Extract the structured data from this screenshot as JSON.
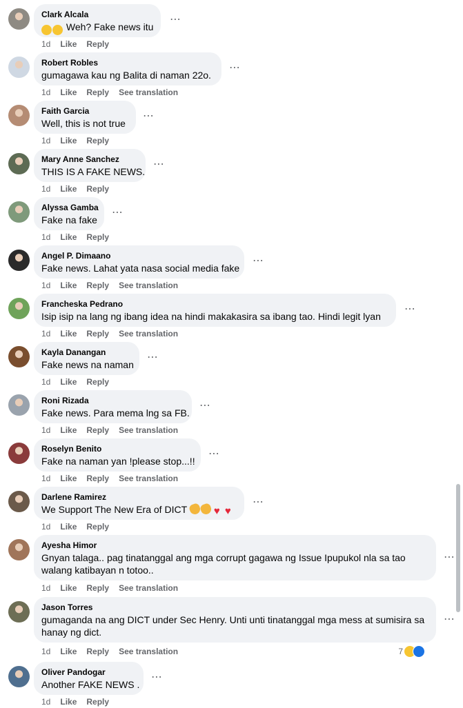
{
  "actions": {
    "like": "Like",
    "reply": "Reply",
    "see_translation": "See translation"
  },
  "more_icon": "⋯",
  "comments": [
    {
      "author": "Clark Alcala",
      "text": "Weh? Fake news itu",
      "time": "1d",
      "translate": false,
      "emojis": [
        "laugh",
        "laugh"
      ],
      "avatar_color": "#8e8a83"
    },
    {
      "author": "Robert Robles",
      "text": "gumagawa kau ng Balita di naman 22o.",
      "time": "1d",
      "translate": true,
      "avatar_color": "#cfd8e3"
    },
    {
      "author": "Faith Garcia",
      "text": "Well, this is not true",
      "time": "1d",
      "translate": false,
      "avatar_color": "#b58c74"
    },
    {
      "author": "Mary Anne Sanchez",
      "text": "THIS IS A FAKE NEWS.",
      "time": "1d",
      "translate": false,
      "avatar_color": "#5d6b54"
    },
    {
      "author": "Alyssa Gamba",
      "text": "Fake na fake",
      "time": "1d",
      "translate": false,
      "avatar_color": "#7f9a7b"
    },
    {
      "author": "Angel P. Dimaano",
      "text": "Fake news. Lahat yata nasa social media fake",
      "time": "1d",
      "translate": true,
      "avatar_color": "#2a2a2a"
    },
    {
      "author": "Francheska Pedrano",
      "text": "Isip isip na lang ng ibang idea na hindi makakasira sa ibang tao. Hindi legit lyan",
      "time": "1d",
      "translate": true,
      "avatar_color": "#6fa35a"
    },
    {
      "author": "Kayla Danangan",
      "text": "Fake news na naman",
      "time": "1d",
      "translate": false,
      "avatar_color": "#7a4e2e"
    },
    {
      "author": "Roni Rizada",
      "text": "Fake news. Para mema lng sa FB.",
      "time": "1d",
      "translate": true,
      "avatar_color": "#9aa3ad"
    },
    {
      "author": "Roselyn Benito",
      "text": "Fake na naman yan !please stop...!!",
      "time": "1d",
      "translate": true,
      "avatar_color": "#8a3b3b"
    },
    {
      "author": "Darlene Ramirez",
      "text": "We Support The New Era of DICT",
      "time": "1d",
      "translate": false,
      "emojis_after": [
        "clap",
        "clap",
        "heart",
        "heart"
      ],
      "avatar_color": "#6b5a4a"
    },
    {
      "author": "Ayesha Himor",
      "text": "Gnyan talaga.. pag tinatanggal ang mga corrupt gagawa ng Issue Ipupukol nla sa tao walang katibayan n totoo..",
      "time": "1d",
      "translate": true,
      "avatar_color": "#a0755a"
    },
    {
      "author": "Jason Torres",
      "text": "gumaganda na ang DICT under Sec Henry. Unti unti tinatanggal mga mess at sumisira sa hanay ng dict.",
      "time": "1d",
      "translate": true,
      "reactions": "7",
      "avatar_color": "#6d6e55"
    },
    {
      "author": "Oliver Pandogar",
      "text": "Another FAKE NEWS .",
      "time": "1d",
      "translate": false,
      "avatar_color": "#4f6f8f"
    }
  ]
}
